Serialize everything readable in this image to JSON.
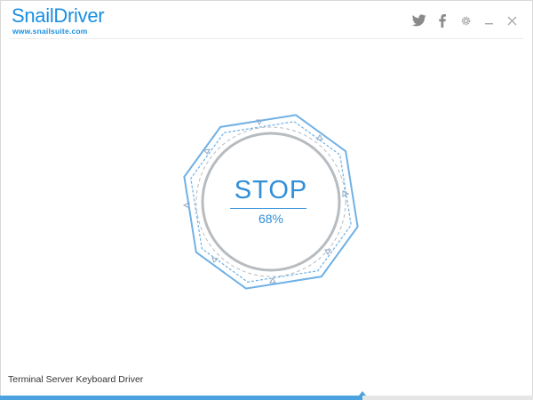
{
  "app": {
    "name": "SnailDriver",
    "website": "www.snailsuite.com"
  },
  "titlebar": {
    "controls": [
      "twitter-icon",
      "facebook-icon",
      "gear-icon",
      "minimize-icon",
      "close-icon"
    ]
  },
  "scan": {
    "action_label": "STOP",
    "progress_text": "68%",
    "progress": 0.68
  },
  "status": {
    "current_item": "Terminal Server Keyboard Driver"
  },
  "colors": {
    "accent": "#2f8fd8",
    "ring": "#b7bcc0",
    "progress": "#4aa3df"
  }
}
